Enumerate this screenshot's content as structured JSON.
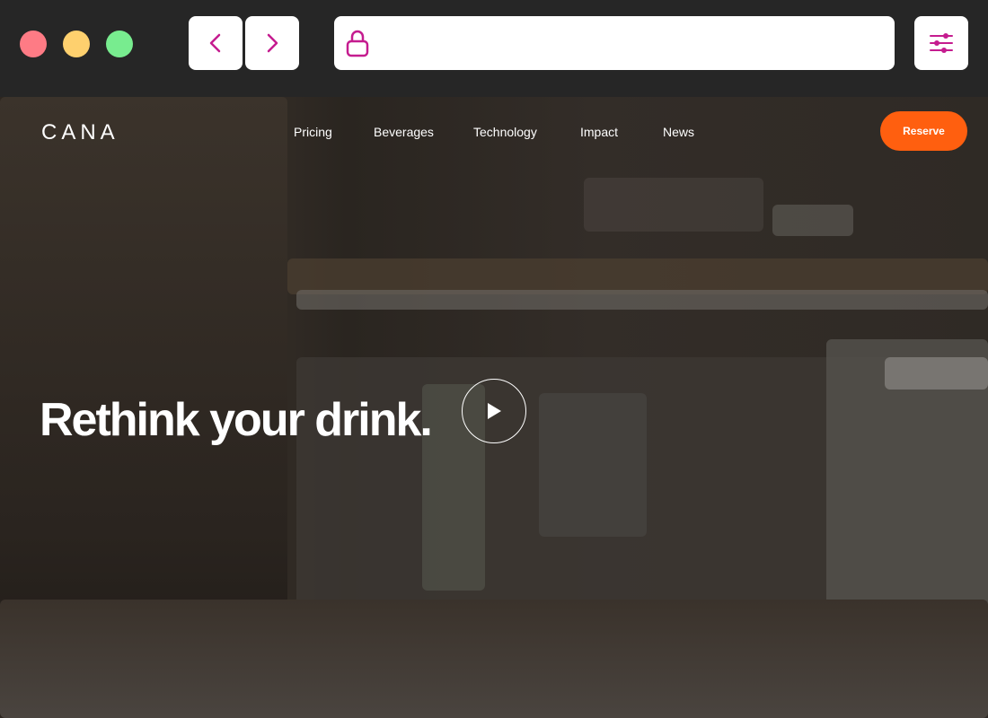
{
  "browser": {
    "window_controls": [
      "close",
      "minimize",
      "maximize"
    ],
    "back_icon": "chevron-left-icon",
    "forward_icon": "chevron-right-icon",
    "lock_icon": "lock-icon",
    "address": "",
    "menu_icon": "sliders-icon",
    "accent_color": "#c51c8f"
  },
  "site": {
    "logo": "CANA",
    "nav": [
      "Pricing",
      "Beverages",
      "Technology",
      "Impact",
      "News"
    ],
    "cta": "Reserve",
    "cta_color": "#ff5f0f"
  },
  "hero": {
    "headline": "Rethink your drink.",
    "play_icon": "play-icon"
  }
}
